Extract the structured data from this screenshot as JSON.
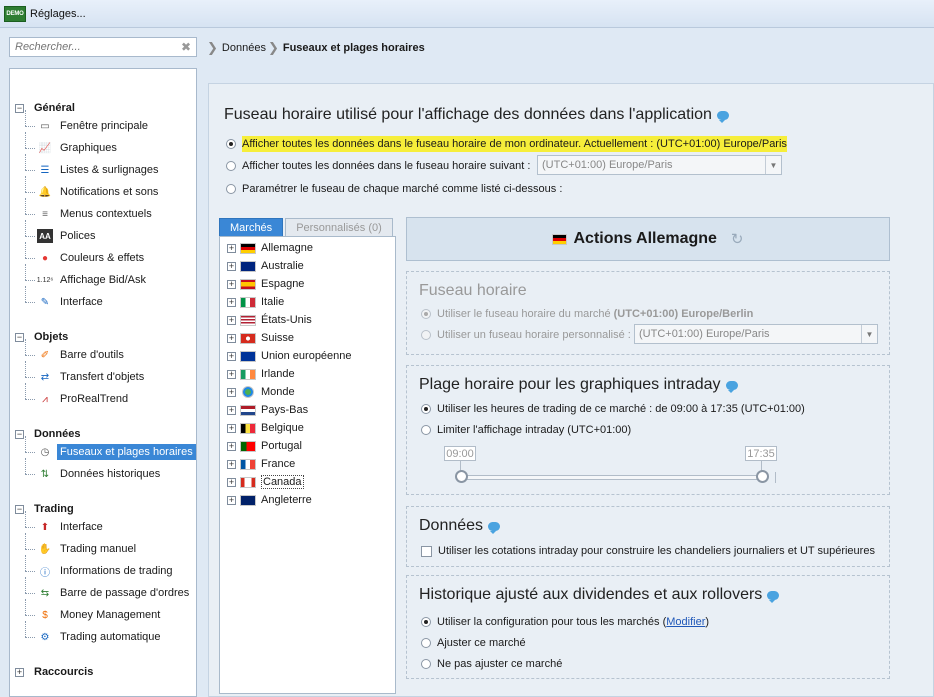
{
  "window": {
    "title": "Réglages...",
    "badge": "DEMO"
  },
  "search": {
    "placeholder": "Rechercher..."
  },
  "sidebar": {
    "groups": [
      {
        "label": "Général",
        "items": [
          {
            "label": "Fenêtre principale",
            "icon": "window-icon"
          },
          {
            "label": "Graphiques",
            "icon": "chart-icon"
          },
          {
            "label": "Listes & surlignages",
            "icon": "list-icon"
          },
          {
            "label": "Notifications et sons",
            "icon": "bell-icon"
          },
          {
            "label": "Menus contextuels",
            "icon": "menu-icon"
          },
          {
            "label": "Polices",
            "icon": "font-icon",
            "glyph": "AA"
          },
          {
            "label": "Couleurs & effets",
            "icon": "color-wheel-icon"
          },
          {
            "label": "Affichage Bid/Ask",
            "icon": "bid-ask-icon",
            "glyph": "1.12⁶"
          },
          {
            "label": "Interface",
            "icon": "interface-icon"
          }
        ]
      },
      {
        "label": "Objets",
        "items": [
          {
            "label": "Barre d'outils",
            "icon": "toolbar-icon"
          },
          {
            "label": "Transfert d'objets",
            "icon": "transfer-icon"
          },
          {
            "label": "ProRealTrend",
            "icon": "trend-icon"
          }
        ]
      },
      {
        "label": "Données",
        "items": [
          {
            "label": "Fuseaux et plages horaires",
            "icon": "clock-icon",
            "selected": true
          },
          {
            "label": "Données historiques",
            "icon": "history-icon"
          }
        ]
      },
      {
        "label": "Trading",
        "items": [
          {
            "label": "Interface",
            "icon": "trading-interface-icon"
          },
          {
            "label": "Trading manuel",
            "icon": "manual-trading-icon"
          },
          {
            "label": "Informations de trading",
            "icon": "info-icon"
          },
          {
            "label": "Barre de passage d'ordres",
            "icon": "order-bar-icon"
          },
          {
            "label": "Money Management",
            "icon": "money-icon"
          },
          {
            "label": "Trading automatique",
            "icon": "gears-icon"
          }
        ]
      },
      {
        "label": "Raccourcis",
        "items": []
      }
    ]
  },
  "breadcrumb": {
    "parent": "Données",
    "current": "Fuseaux et plages horaires"
  },
  "timezone": {
    "title": "Fuseau horaire utilisé pour l'affichage des données dans l'application",
    "option1": "Afficher toutes les données dans le fuseau horaire de mon ordinateur. Actuellement : (UTC+01:00) Europe/Paris",
    "option2": "Afficher toutes les données dans le fuseau horaire suivant :",
    "option2_select": "(UTC+01:00) Europe/Paris",
    "option3": "Paramétrer le fuseau de chaque marché comme listé ci-dessous :"
  },
  "markets": {
    "tab_active": "Marchés",
    "tab_inactive": "Personnalisés (0)",
    "list": [
      {
        "name": "Allemagne",
        "flag": "de"
      },
      {
        "name": "Australie",
        "flag": "au"
      },
      {
        "name": "Espagne",
        "flag": "es"
      },
      {
        "name": "Italie",
        "flag": "it"
      },
      {
        "name": "États-Unis",
        "flag": "us"
      },
      {
        "name": "Suisse",
        "flag": "ch"
      },
      {
        "name": "Union européenne",
        "flag": "eu"
      },
      {
        "name": "Irlande",
        "flag": "ie"
      },
      {
        "name": "Monde",
        "flag": "world"
      },
      {
        "name": "Pays-Bas",
        "flag": "nl"
      },
      {
        "name": "Belgique",
        "flag": "be"
      },
      {
        "name": "Portugal",
        "flag": "pt"
      },
      {
        "name": "France",
        "flag": "fr"
      },
      {
        "name": "Canada",
        "flag": "ca",
        "selected": true
      },
      {
        "name": "Angleterre",
        "flag": "gb"
      }
    ]
  },
  "detail": {
    "title": "Actions Allemagne",
    "fuseau": {
      "title": "Fuseau horaire",
      "opt1_prefix": "Utiliser le fuseau horaire du marché",
      "opt1_value": "(UTC+01:00) Europe/Berlin",
      "opt2": "Utiliser un fuseau horaire personnalisé :",
      "opt2_select": "(UTC+01:00) Europe/Paris"
    },
    "plage": {
      "title": "Plage horaire pour les graphiques intraday",
      "opt1": "Utiliser les heures de trading de ce marché : de 09:00 à 17:35 (UTC+01:00)",
      "opt2": "Limiter l'affichage intraday  (UTC+01:00)",
      "slider_start": "09:00",
      "slider_end": "17:35"
    },
    "donnees": {
      "title": "Données",
      "checkbox": "Utiliser les cotations intraday pour construire les chandeliers journaliers et UT supérieures"
    },
    "historique": {
      "title": "Historique ajusté aux dividendes et aux rollovers",
      "opt1_prefix": "Utiliser la configuration pour tous les marchés (",
      "opt1_link": "Modifier",
      "opt1_suffix": ")",
      "opt2": "Ajuster ce marché",
      "opt3": "Ne pas ajuster ce marché"
    }
  }
}
